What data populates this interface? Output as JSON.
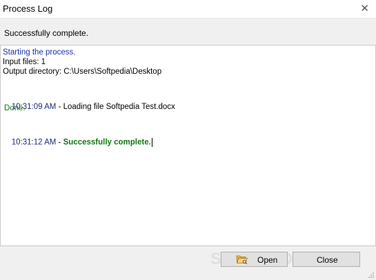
{
  "window": {
    "title": "Process Log",
    "close_glyph": "✕"
  },
  "status_message": "Successfully complete.",
  "log": {
    "start": "Starting the process.",
    "input_files": "Input files: 1",
    "output_dir": "Output directory: C:\\Users\\Softpedia\\Desktop",
    "entry1_time": "10:31:09 AM",
    "entry1_sep": " - ",
    "entry1_msg": "Loading file Softpedia Test.docx",
    "entry1_done": "Done.",
    "entry2_time": "10:31:12 AM",
    "entry2_sep": " - ",
    "entry2_msg": "Successfully complete."
  },
  "buttons": {
    "open_label": "Open",
    "close_label": "Close"
  },
  "watermark": "SOFTPEDIA",
  "icons": {
    "open_button": "folder-open-icon",
    "close_window": "close-icon",
    "resize": "resize-grip-icon"
  },
  "colors": {
    "log_blue": "#1a2fb0",
    "timestamp": "#1c2a78",
    "success_green": "#127812"
  }
}
